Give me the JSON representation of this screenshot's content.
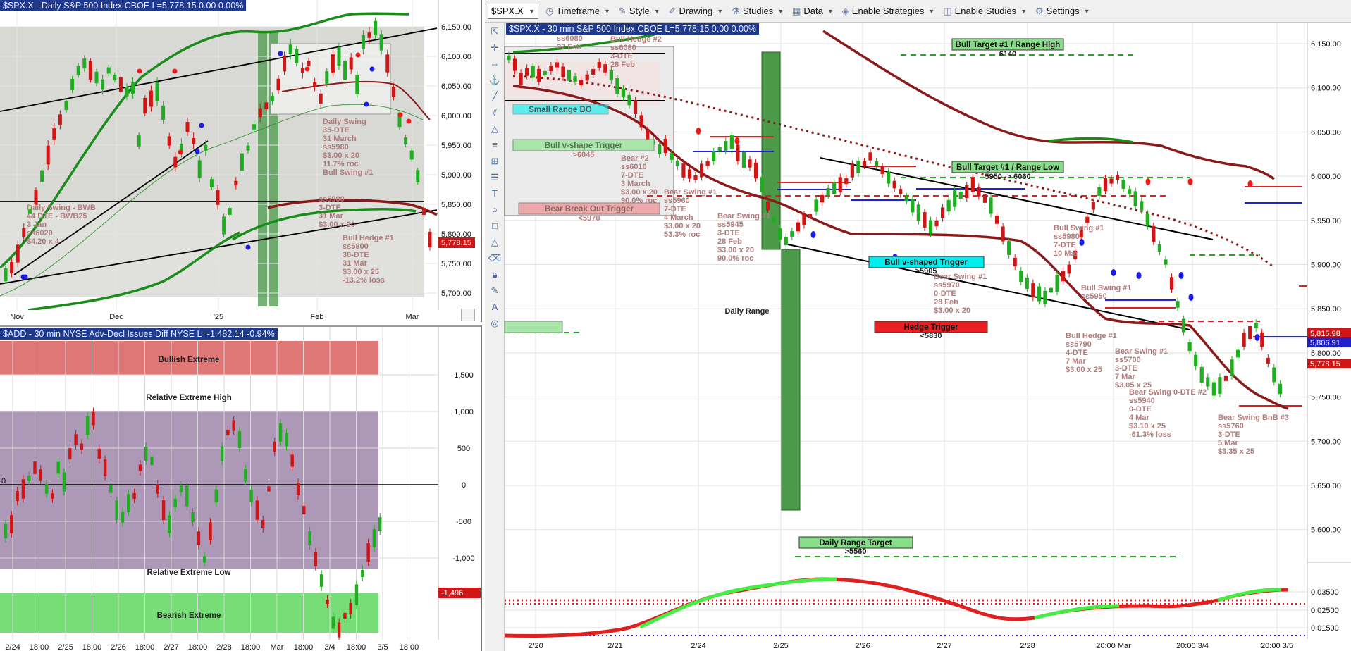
{
  "toolbar": {
    "symbol": "$SPX.X",
    "items": [
      {
        "label": "Timeframe",
        "icon": "clock-icon"
      },
      {
        "label": "Style",
        "icon": "brush-icon"
      },
      {
        "label": "Drawing",
        "icon": "pencil-icon"
      },
      {
        "label": "Studies",
        "icon": "studies-icon"
      },
      {
        "label": "Data",
        "icon": "table-icon"
      },
      {
        "label": "Enable Strategies",
        "icon": "strategy-icon"
      },
      {
        "label": "Enable Studies",
        "icon": "studies-toggle-icon"
      },
      {
        "label": "Settings",
        "icon": "gear-icon"
      }
    ]
  },
  "daily": {
    "header": "$SPX.X - Daily  S&P 500 Index  CBOE  L=5,778.15  0.00  0.00%",
    "y_ticks": [
      "6,150.00",
      "6,100.00",
      "6,050.00",
      "6,000.00",
      "5,950.00",
      "5,900.00",
      "5,850.00",
      "5,800.00",
      "5,750.00",
      "5,700.00"
    ],
    "x_ticks": [
      "Nov",
      "Dec",
      "'25",
      "Feb",
      "Mar"
    ],
    "last_price": "5,778.15",
    "annotations": [
      "Daily Swing - BWB",
      "44 DTE - BWB25",
      "3 Jan",
      "ss6020",
      "$4.20 x 4",
      "Daily Swing",
      "35-DTE",
      "31 March",
      "ss5980",
      "$3.00 x 20",
      "11.7% roc",
      "Bull Swing #1",
      "ss5900",
      "3-DTE",
      "31 Mar",
      "$3.00 x 20",
      "Bull Hedge #1",
      "ss5800",
      "30-DTE",
      "31 Mar",
      "$3.00 x 25",
      "-13.2% loss"
    ]
  },
  "add": {
    "header": "$ADD - 30 min  NYSE Adv-Decl Issues Diff  NYSE  L=-1,482.14    -0.94%",
    "zones": [
      "Bullish Extreme",
      "Relative Extreme High",
      "Relative Extreme Low",
      "Bearish Extreme"
    ],
    "y_ticks": [
      "1,500",
      "1,000",
      "500",
      "0",
      "-500",
      "-1,000"
    ],
    "zero_label": "0",
    "last_value": "-1,496",
    "x_ticks": [
      "2/24",
      "18:00",
      "2/25",
      "18:00",
      "2/26",
      "18:00",
      "2/27",
      "18:00",
      "2/28",
      "18:00",
      "Mar",
      "18:00",
      "3/4",
      "18:00",
      "3/5",
      "18:00"
    ]
  },
  "main": {
    "header": "$SPX.X - 30 min  S&P 500 Index  CBOE  L=5,778.15  0.00  0.00%",
    "y_ticks": [
      "6,150.00",
      "6,100.00",
      "6,050.00",
      "6,000.00",
      "5,950.00",
      "5,900.00",
      "5,850.00",
      "5,800.00",
      "5,750.00",
      "5,700.00",
      "5,650.00",
      "5,600.00"
    ],
    "lower_ticks": [
      "0.03500",
      "0.02500",
      "0.01500"
    ],
    "price_tags": [
      "5,815.98",
      "5,806.91",
      "5,778.15"
    ],
    "x_ticks": [
      "2/20",
      "2/21",
      "2/24",
      "2/25",
      "2/26",
      "2/27",
      "2/28",
      "20:00 Mar",
      "20:00 3/4",
      "20:00 3/5"
    ],
    "boxes": {
      "bull_target_high": "Bull Target #1 / Range High",
      "bull_target_high_val": "6140",
      "bull_target_low": "Bull Target #1 / Range Low",
      "bull_target_low_val": "5950 -> 6060",
      "bull_v_trigger": "Bull v-shaped Trigger",
      "bull_v_trigger_val": ">5905",
      "hedge_trigger": "Hedge Trigger",
      "hedge_trigger_val": "<5830",
      "daily_range": "Daily Range",
      "daily_range_target": "Daily Range Target",
      "daily_range_target_val": ">5560",
      "small_range_bo": "Small Range BO",
      "bull_v_shape_trigger": "Bull v-shape Trigger",
      "bull_v_shape_trigger_val": ">6045",
      "bear_break_out": "Bear Break Out Trigger",
      "bear_break_out_val": "<5970"
    },
    "annotations": [
      "Bear Swing #1",
      "ss6080",
      "27 Feb",
      "Bull Hedge #2",
      "ss6080",
      "3-DTE",
      "28 Feb",
      "Bear #2",
      "ss6010",
      "7-DTE",
      "3 March",
      "$3.00 x 20",
      "90.0% roc",
      "Bear Swing #1",
      "ss5960",
      "7-DTE",
      "4 March",
      "$3.00 x 20",
      "53.3% roc",
      "Bear Swing #1",
      "ss5945",
      "3-DTE",
      "28 Feb",
      "$3.00 x 20",
      "90.0% roc",
      "Bear Swing #1",
      "ss5970",
      "0-DTE",
      "28 Feb",
      "$3.00 x 20",
      "Bull Swing #1",
      "ss5980",
      "7-DTE",
      "10 Mar",
      "Bull Hedge #1",
      "ss5790",
      "4-DTE",
      "7 Mar",
      "$3.00 x 25",
      "Bull Swing #1",
      "ss5950",
      "Bear Swing #1",
      "ss5700",
      "3-DTE",
      "7 Mar",
      "$3.05 x 25",
      "Bear Swing 0-DTE #2",
      "ss5940",
      "0-DTE",
      "4 Mar",
      "$3.10 x 25",
      "-61.3% loss",
      "Bear Swing BnB #3",
      "ss5760",
      "3-DTE",
      "5 Mar",
      "$3.35 x 25"
    ]
  },
  "colors": {
    "up": "#1fae1f",
    "down": "#d11414",
    "header_bg": "#1f3a8c",
    "ma_red": "#8b1a1a",
    "ma_green": "#1a8c1a",
    "bull_green": "#88dd88",
    "bear_red": "#e85555",
    "cyan": "#00eeee"
  }
}
